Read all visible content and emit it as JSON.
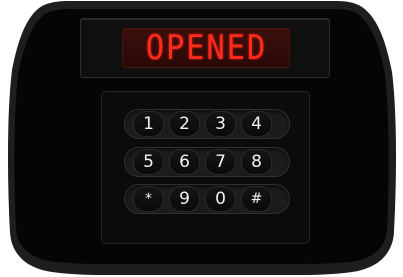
{
  "display": {
    "text": "OPENED",
    "color": "#ff2a1c"
  },
  "keypad": {
    "rows": [
      [
        "1",
        "2",
        "3",
        "4"
      ],
      [
        "5",
        "6",
        "7",
        "8"
      ],
      [
        "*",
        "9",
        "0",
        "#"
      ]
    ]
  },
  "colors": {
    "body": "#050505",
    "bezel": "#1f1f1f",
    "key_text": "#f2f2f2"
  }
}
